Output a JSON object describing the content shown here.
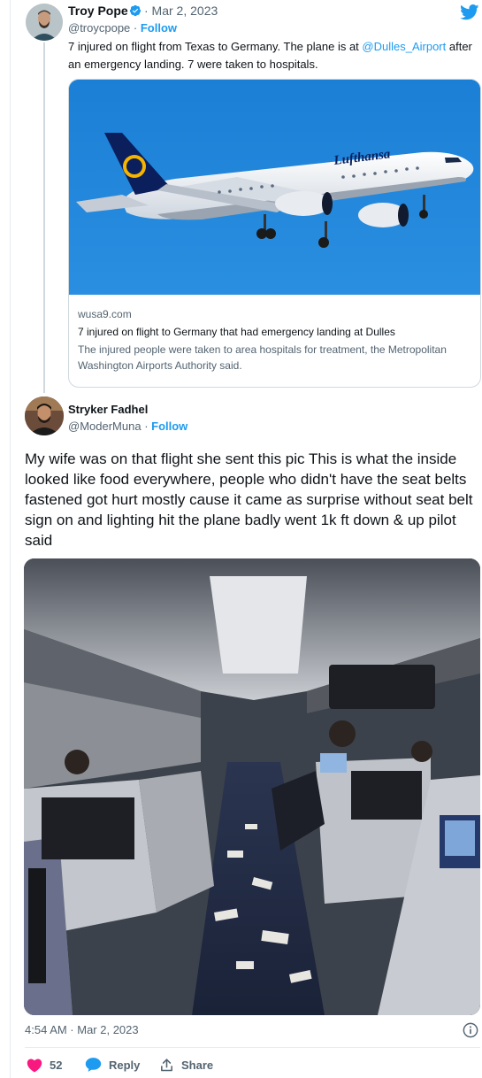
{
  "quoted_tweet": {
    "author_name": "Troy Pope",
    "date": "· Mar 2, 2023",
    "handle": "@troycpope",
    "separator": " · ",
    "follow_label": "Follow",
    "text_before_mention": "7 injured on flight from Texas to Germany. The plane is at ",
    "mention": "@Dulles_Airport",
    "text_after_mention": " after an emergency landing. 7 were taken to hospitals.",
    "card": {
      "domain": "wusa9.com",
      "title": "7 injured on flight to Germany that had emergency landing at Dulles",
      "description": "The injured people were taken to area hospitals for treatment, the Metropolitan Washington Airports Authority said.",
      "airline_livery": "Lufthansa"
    }
  },
  "main_tweet": {
    "author_name": "Stryker Fadhel",
    "handle": "@ModerMuna",
    "separator": " · ",
    "follow_label": "Follow",
    "text": "My wife was on that flight she sent this pic This is what the inside looked like food everywhere, people who didn't have the seat belts fastened got hurt mostly cause it came as surprise without seat belt sign on and lighting hit the plane badly went 1k ft down & up pilot said",
    "timestamp": "4:54 AM · Mar 2, 2023",
    "actions": {
      "like_count": "52",
      "reply_label": "Reply",
      "share_label": "Share"
    }
  },
  "icons": {
    "verified": "verified-badge-icon",
    "brand": "twitter-bird-icon",
    "info": "info-icon",
    "like": "heart-icon",
    "reply": "reply-bubble-icon",
    "share": "share-icon"
  },
  "colors": {
    "brand_blue": "#1d9bf0",
    "like_red": "#f91880",
    "text_primary": "#0f1419",
    "text_secondary": "#536471"
  }
}
